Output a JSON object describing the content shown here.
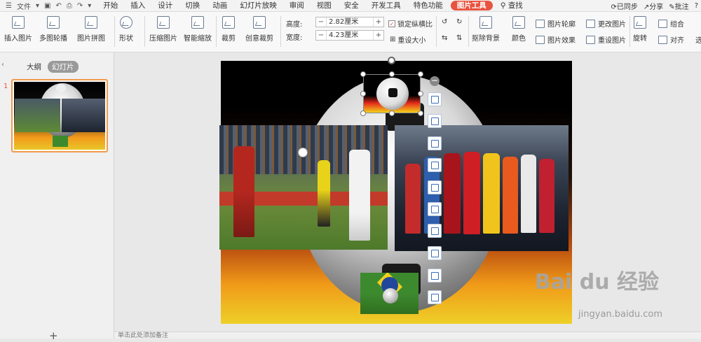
{
  "menubar": {
    "file_label": "文件",
    "tabs": [
      "开始",
      "插入",
      "设计",
      "切换",
      "动画",
      "幻灯片放映",
      "审阅",
      "视图",
      "安全",
      "开发工具",
      "特色功能",
      "图片工具"
    ],
    "active_tab": "图片工具",
    "search_label": "查找",
    "sync_label": "已同步",
    "share_label": "分享",
    "comment_label": "批注",
    "help_label": "?"
  },
  "ribbon": {
    "insert_pic": "插入图片",
    "multi_carousel": "多图轮播",
    "pic_collage": "图片拼图",
    "shape": "形状",
    "compress": "压缩图片",
    "smart_zoom": "智能缩放",
    "crop": "裁剪",
    "creative_crop": "创意裁剪",
    "height_label": "高度:",
    "height_value": "2.82厘米",
    "width_label": "宽度:",
    "width_value": "4.23厘米",
    "lock_ratio": "锁定纵横比",
    "reset_size": "重设大小",
    "remove_bg": "抠除背景",
    "color": "颜色",
    "pic_outline": "图片轮廓",
    "pic_effect": "图片效果",
    "change_pic": "更改图片",
    "reset_pic": "重设图片",
    "rotate": "旋转",
    "group": "组合",
    "align": "对齐",
    "select": "选"
  },
  "panel": {
    "outline_tab": "大纲",
    "slides_tab": "幻灯片",
    "slide_number": "1",
    "add_slide": "+"
  },
  "notes": {
    "placeholder": "单击此处添加备注"
  },
  "watermark": {
    "brand": "Bai du 经验",
    "url": "jingyan.baidu.com"
  },
  "colors": {
    "accent": "#e8533f",
    "selection": "#f19a4c",
    "float_icon": "#3a6fb5"
  }
}
